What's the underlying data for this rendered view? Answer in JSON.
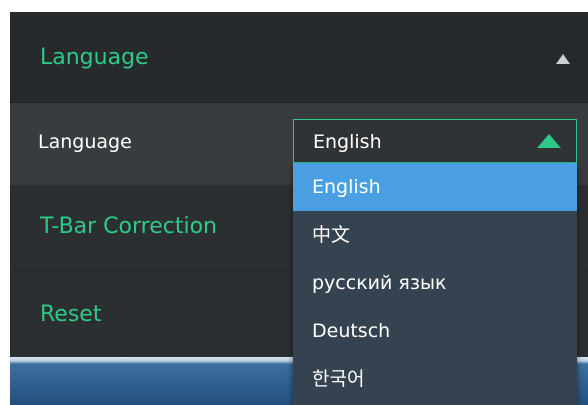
{
  "language_section": {
    "title": "Language",
    "field_label": "Language",
    "selected_value": "English"
  },
  "sections": {
    "tbar": "T-Bar Correction",
    "reset": "Reset"
  },
  "dropdown": {
    "options": [
      "English",
      "中文",
      "русский язык",
      "Deutsch",
      "한국어"
    ],
    "highlighted": "English"
  },
  "colors": {
    "accent": "#2ec988",
    "highlight": "#4a9fe3",
    "panel": "#2c2f31",
    "row": "#383c3f",
    "dropdown_bg": "#354250"
  },
  "icons": {
    "section_toggle": "caret-up-icon",
    "select_toggle": "caret-up-icon"
  }
}
